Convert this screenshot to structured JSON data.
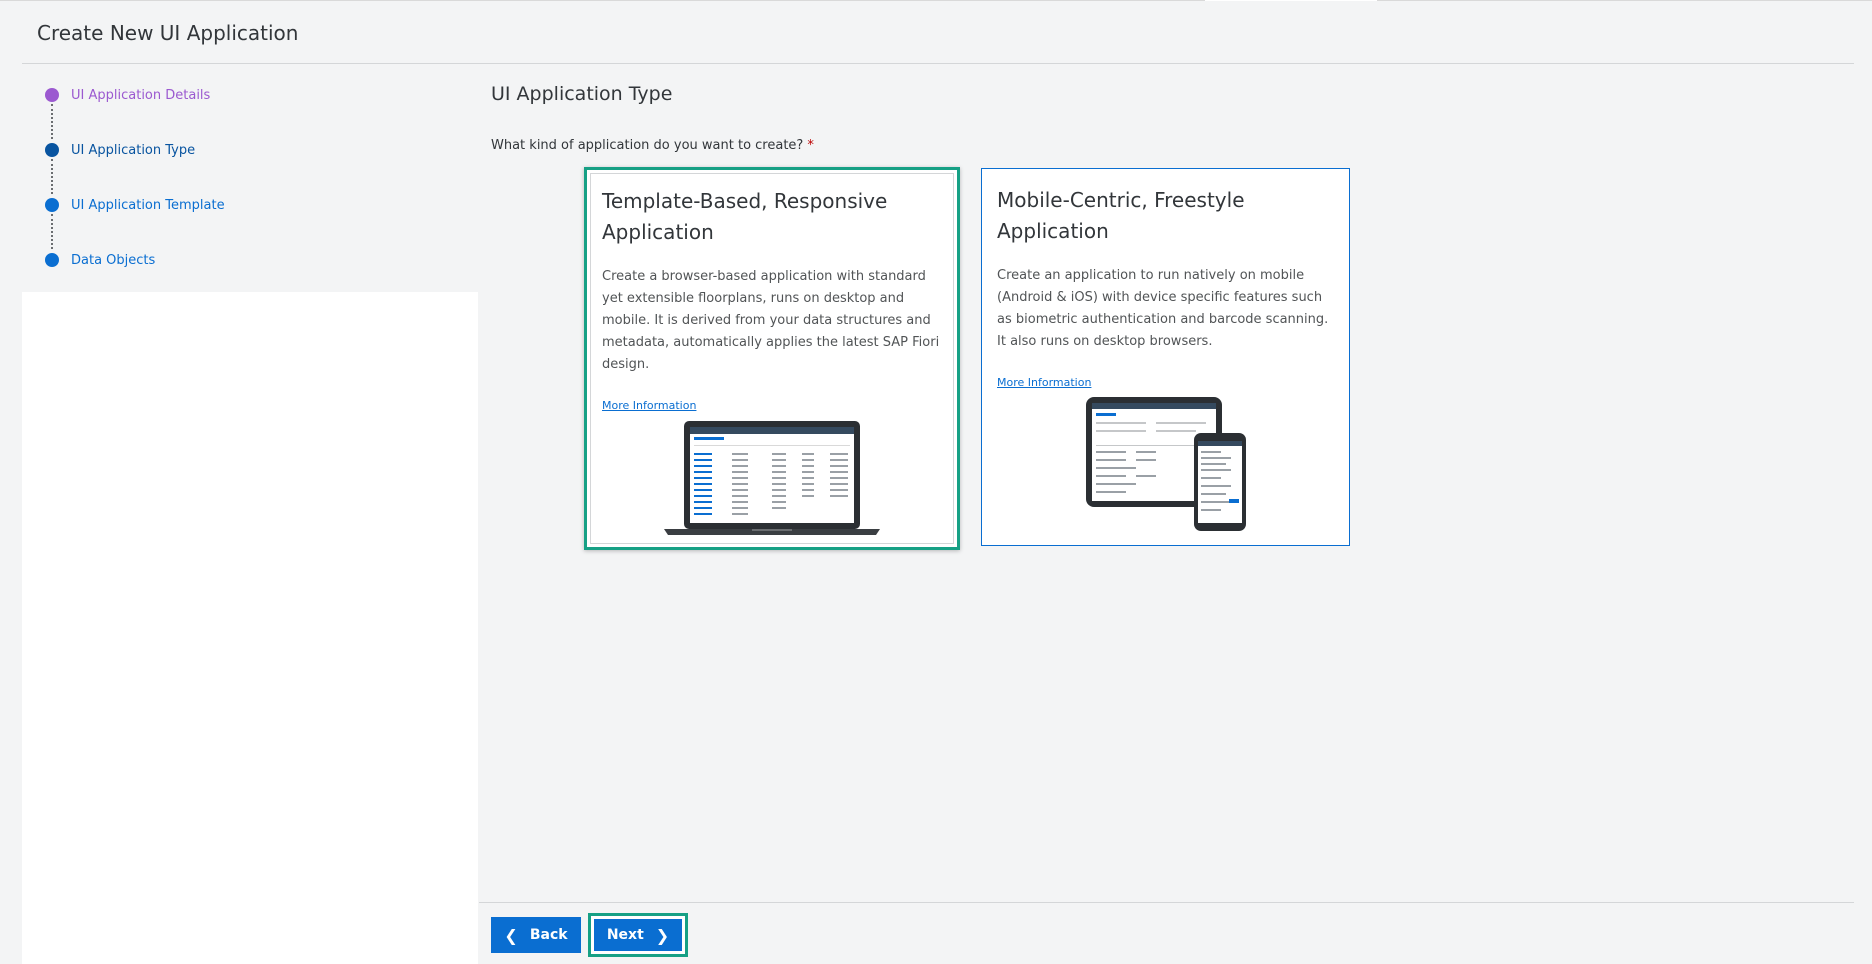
{
  "header": {
    "title": "Create New UI Application"
  },
  "wizard": {
    "steps": [
      {
        "label": "UI Application Details",
        "state": "completed"
      },
      {
        "label": "UI Application Type",
        "state": "current"
      },
      {
        "label": "UI Application Template",
        "state": "upcoming"
      },
      {
        "label": "Data Objects",
        "state": "upcoming"
      }
    ]
  },
  "main": {
    "section_title": "UI Application Type",
    "question": "What kind of application do you want to create?",
    "required_marker": "*",
    "cards": [
      {
        "title": "Template-Based, Responsive Application",
        "description": "Create a browser-based application with standard yet extensible floorplans, runs on desktop and mobile. It is derived from your data structures and metadata, automatically applies the latest SAP Fiori design.",
        "link": "More Information",
        "selected": true,
        "illustration": "laptop-illustration"
      },
      {
        "title": "Mobile-Centric, Freestyle Application",
        "description": "Create an application to run natively on mobile (Android & iOS) with device specific features such as biometric authentication and barcode scanning. It also runs on desktop browsers.",
        "link": "More Information",
        "selected": false,
        "illustration": "tablet-phone-illustration"
      }
    ]
  },
  "footer": {
    "back_label": "Back",
    "next_label": "Next"
  },
  "colors": {
    "accent": "#0a6ed1",
    "selection": "#16a085",
    "completed": "#9b59d0"
  }
}
